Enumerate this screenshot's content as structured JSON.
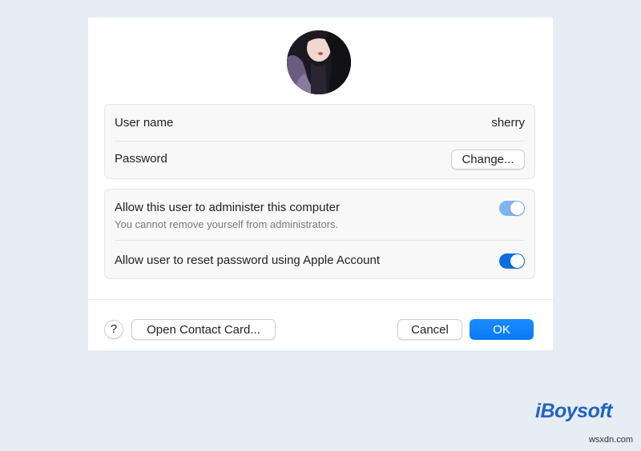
{
  "user": {
    "username_label": "User name",
    "username_value": "sherry",
    "password_label": "Password",
    "change_button": "Change..."
  },
  "permissions": {
    "admin_label": "Allow this user to administer this computer",
    "admin_sublabel": "You cannot remove yourself from administrators.",
    "admin_enabled": true,
    "admin_toggle_disabled": true,
    "reset_label": "Allow user to reset password using Apple Account",
    "reset_enabled": true
  },
  "footer": {
    "help_label": "?",
    "contact_button": "Open Contact Card...",
    "cancel_button": "Cancel",
    "ok_button": "OK"
  },
  "colors": {
    "accent": "#0a79f5",
    "toggle_disabled": "#80b4f0",
    "toggle_on": "#0a6fe0",
    "logo_blue": "#1f63c6"
  },
  "branding": {
    "logo": "iBoysoft",
    "watermark": "wsxdn.com"
  },
  "icons": {
    "avatar": "user-photo-avatar",
    "help": "question-mark-icon"
  }
}
